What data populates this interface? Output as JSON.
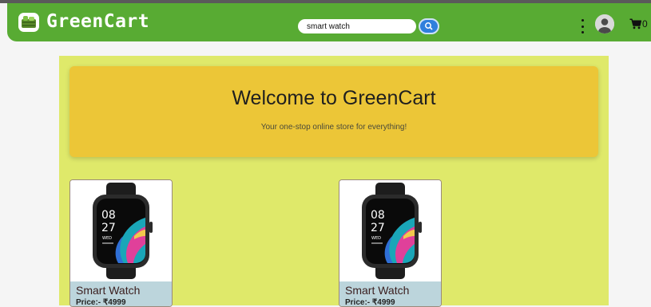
{
  "navbar": {
    "brand": "GreenCart",
    "logo_icon": "basket-logo-icon",
    "search": {
      "value": "smart watch",
      "icon": "search-icon"
    },
    "menu_icon": "kebab-menu-icon",
    "avatar_icon": "user-avatar-icon",
    "cart": {
      "icon": "cart-icon",
      "count": "0"
    }
  },
  "banner": {
    "title": "Welcome to GreenCart",
    "subtitle": "Your one-stop online store for everything!"
  },
  "products": [
    {
      "name": "Smart Watch",
      "price": "Price:- ₹4999",
      "watch_hour": "08",
      "watch_minute": "27",
      "watch_day": "WED"
    },
    {
      "name": "Smart Watch",
      "price": "Price:- ₹4999",
      "watch_hour": "08",
      "watch_minute": "27",
      "watch_day": "WED"
    }
  ],
  "colors": {
    "navbar": "#58ab33",
    "page_bg": "#dfe96a",
    "banner_bg": "#ecc637",
    "card_info_bg": "#bcd5dc",
    "search_button": "#2f7fdc"
  }
}
